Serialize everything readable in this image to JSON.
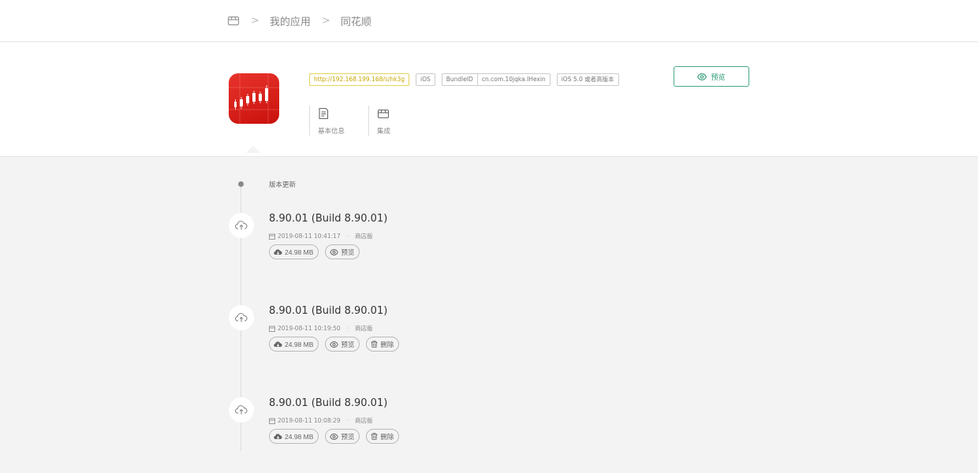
{
  "breadcrumb": {
    "separator": ">",
    "items": [
      {
        "label": "我的应用"
      },
      {
        "label": "同花顺"
      }
    ]
  },
  "app": {
    "tags": {
      "url": "http://192.168.199.168/s/hk3g",
      "platform": "iOS",
      "bundle_key": "BundleID",
      "bundle_value": "cn.com.10jqka.IHexin",
      "min_os": "iOS 5.0 或者高版本"
    },
    "preview_label": "预览",
    "tabs": [
      {
        "label": "基本信息"
      },
      {
        "label": "集成"
      }
    ]
  },
  "timeline": {
    "heading": "版本更新",
    "entries": [
      {
        "title": "8.90.01 (Build 8.90.01)",
        "date": "2019-08-11 10:41:17",
        "channel": "商店版",
        "size": "24.98 MB",
        "preview_label": "预览"
      },
      {
        "title": "8.90.01 (Build 8.90.01)",
        "date": "2019-08-11 10:19:50",
        "channel": "商店版",
        "size": "24.98 MB",
        "preview_label": "预览",
        "delete_label": "删除"
      },
      {
        "title": "8.90.01 (Build 8.90.01)",
        "date": "2019-08-11 10:08:29",
        "channel": "商店版",
        "size": "24.98 MB",
        "preview_label": "预览",
        "delete_label": "删除"
      }
    ]
  },
  "colors": {
    "accent": "#2f9a78",
    "app_icon_red": "#d8211b",
    "url_tag": "#c7a900"
  },
  "icons": {
    "home": "box-icon",
    "preview": "eye-icon",
    "basic_info": "document-icon",
    "integration": "box-icon",
    "entry_node": "cloud-upload-icon",
    "size": "cloud-download-icon",
    "delete": "trash-icon",
    "date": "calendar-icon"
  }
}
